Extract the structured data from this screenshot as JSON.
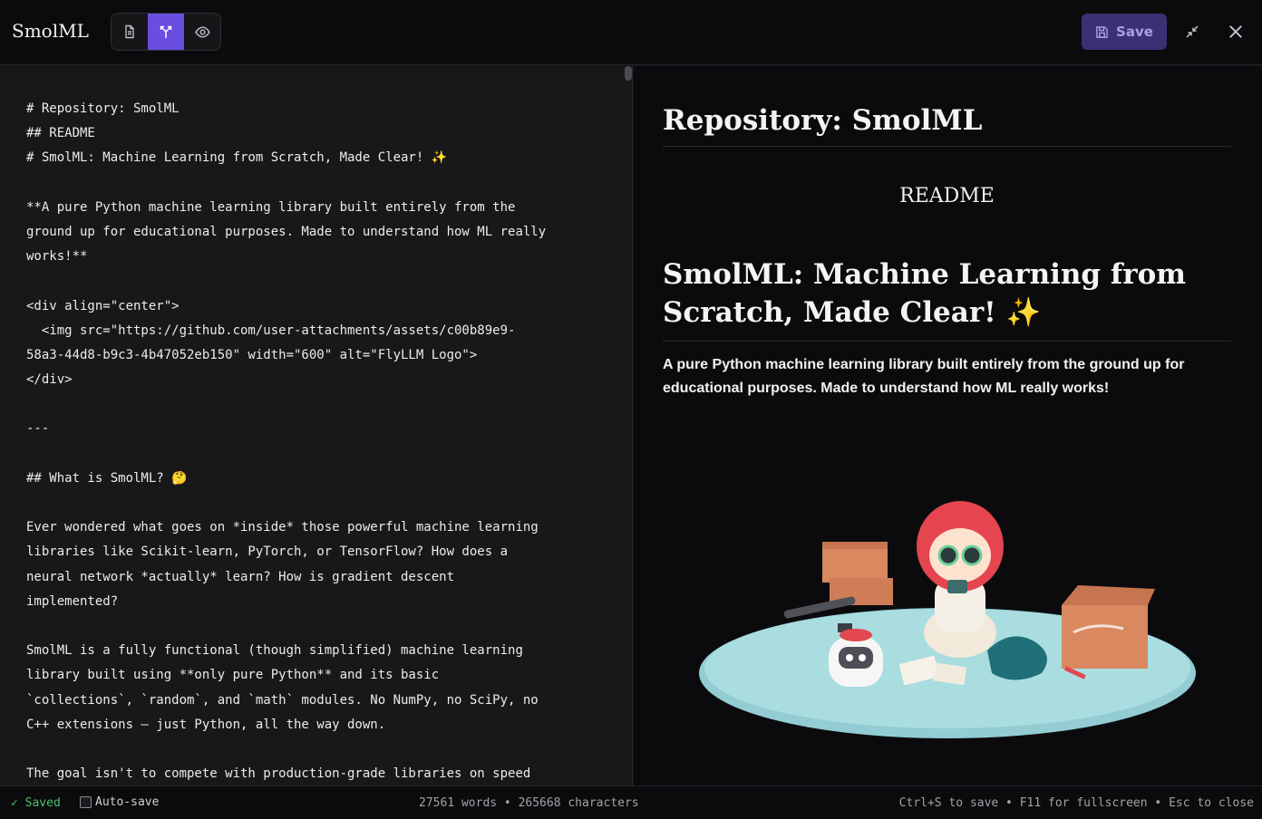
{
  "app": {
    "title": "SmolML"
  },
  "toolbar": {
    "modes": [
      "edit-mode",
      "split-mode",
      "preview-mode"
    ],
    "active_mode": "split-mode",
    "save_label": "Save",
    "accent": "#6a4ee0"
  },
  "editor": {
    "lines": [
      "# Repository: SmolML",
      "## README",
      "# SmolML: Machine Learning from Scratch, Made Clear! ✨",
      "",
      "**A pure Python machine learning library built entirely from the",
      "ground up for educational purposes. Made to understand how ML really",
      "works!**",
      "",
      "<div align=\"center\">",
      "  <img src=\"https://github.com/user-attachments/assets/c00b89e9-",
      "58a3-44d8-b9c3-4b47052eb150\" width=\"600\" alt=\"FlyLLM Logo\">",
      "</div>",
      "",
      "---",
      "",
      "## What is SmolML? 🤔",
      "",
      "Ever wondered what goes on *inside* those powerful machine learning",
      "libraries like Scikit-learn, PyTorch, or TensorFlow? How does a",
      "neural network *actually* learn? How is gradient descent",
      "implemented?",
      "",
      "SmolML is a fully functional (though simplified) machine learning",
      "library built using **only pure Python** and its basic",
      "`collections`, `random`, and `math` modules. No NumPy, no SciPy, no",
      "C++ extensions – just Python, all the way down.",
      "",
      "The goal isn't to compete with production-grade libraries on speed"
    ]
  },
  "preview": {
    "h1": "Repository: SmolML",
    "center_text": "README",
    "h2": "SmolML: Machine Learning from Scratch, Made Clear! ✨",
    "paragraph": "A pure Python machine learning library built entirely from the ground up for educational purposes. Made to understand how ML really works!"
  },
  "status": {
    "saved": "✓ Saved",
    "autosave_label": "Auto-save",
    "autosave_checked": false,
    "counts": "27561 words • 265668 characters",
    "hints": "Ctrl+S to save • F11 for fullscreen • Esc to close"
  }
}
